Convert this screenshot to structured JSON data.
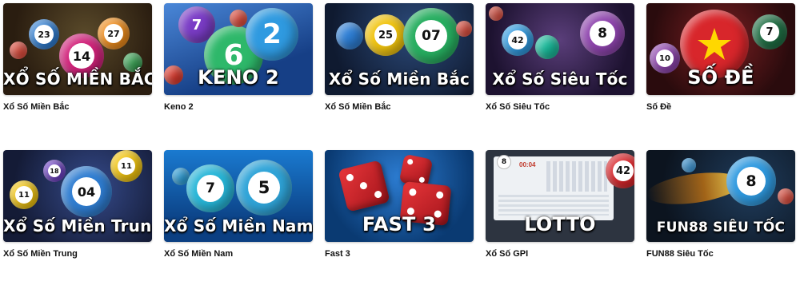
{
  "games": [
    {
      "label": "Xổ Số Miền Bắc",
      "banner": "XỔ SỐ MIỀN BẮC"
    },
    {
      "label": "Keno 2",
      "banner": "KENO 2"
    },
    {
      "label": "Xổ Số Miền Bắc",
      "banner": "Xổ Số Miền Bắc"
    },
    {
      "label": "Xổ Số Siêu Tốc",
      "banner": "Xổ Số Siêu Tốc"
    },
    {
      "label": "Số Đề",
      "banner": "SỐ ĐỀ"
    },
    {
      "label": "Xổ Số Miền Trung",
      "banner": "Xổ Số Miền Trung"
    },
    {
      "label": "Xổ Số Miền Nam",
      "banner": "Xổ Số Miền Nam"
    },
    {
      "label": "Fast 3",
      "banner": "FAST 3"
    },
    {
      "label": "Xổ Số GPI",
      "banner": "LOTTO"
    },
    {
      "label": "FUN88 Siêu Tốc",
      "banner": "FUN88 SIÊU TỐC"
    }
  ],
  "balls": {
    "g0": [
      "23",
      "14",
      "27"
    ],
    "g1": [
      "7",
      "6",
      "2"
    ],
    "g2": [
      "25",
      "07"
    ],
    "g3": [
      "42",
      "8"
    ],
    "g4": [
      "10",
      "7"
    ],
    "g5": [
      "11",
      "18",
      "04",
      "11"
    ],
    "g6": [
      "7",
      "5"
    ],
    "g8": [
      "8",
      "42"
    ],
    "g9": [
      "8"
    ]
  },
  "lotto_screen": {
    "timer": "00:04"
  },
  "colors": {
    "tile0": "#3a2a1c",
    "tile1": "#1f4f9a",
    "tile2": "#16233e",
    "tile3": "#2a1e3f",
    "tile4": "#4a1418",
    "tile5": "#24305a",
    "tile6": "#10579e",
    "tile7": "#0e4f8a",
    "tile8": "#e9ecef",
    "tile9": "#1c2a3c"
  }
}
